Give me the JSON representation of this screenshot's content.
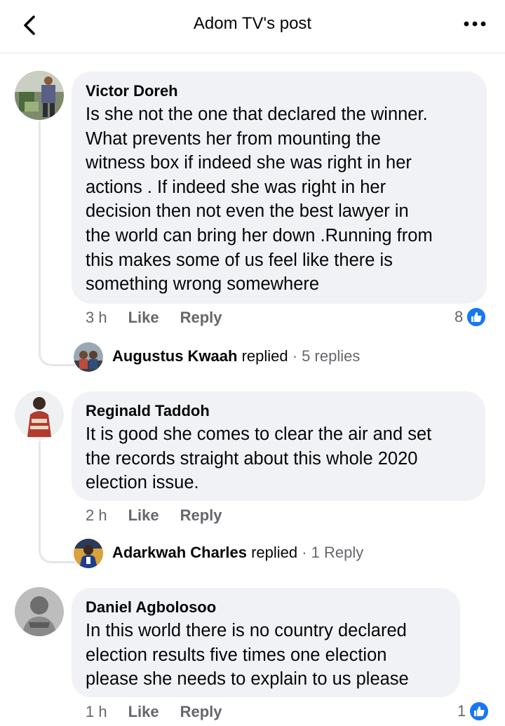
{
  "header": {
    "title": "Adom TV's post",
    "back_icon": "chevron-left-icon",
    "more_icon": "more-horizontal-icon"
  },
  "comments": [
    {
      "author": "Victor Doreh",
      "lines": [
        "Is she not the one that declared the winner.",
        "What prevents her from mounting the",
        "witness box if indeed she was right in her",
        "actions . If indeed she was right in her",
        "decision then not even the best lawyer in",
        "the world can bring her down .Running from",
        "this makes some of us feel like there is",
        "something wrong somewhere"
      ],
      "time": "3 h",
      "like_label": "Like",
      "reply_label": "Reply",
      "reaction_count": "8",
      "reply_preview": {
        "name": "Augustus Kwaah",
        "verb": " replied",
        "count": " · 5 replies"
      }
    },
    {
      "author": "Reginald Taddoh",
      "lines": [
        "It is good she comes to clear the air and set",
        "the records straight about this whole 2020",
        "election issue."
      ],
      "time": "2 h",
      "like_label": "Like",
      "reply_label": "Reply",
      "reply_preview": {
        "name": "Adarkwah Charles",
        "verb": " replied",
        "count": " · 1 Reply"
      }
    },
    {
      "author": "Daniel Agbolosoo",
      "lines": [
        "In this world there is no country declared",
        "election results five times one election",
        "please she needs to explain to us please"
      ],
      "time": "1 h",
      "like_label": "Like",
      "reply_label": "Reply",
      "reaction_count": "1"
    }
  ],
  "colors": {
    "accent": "#1877f2",
    "bubble": "#f0f2f5",
    "secondary_text": "#65676b"
  }
}
